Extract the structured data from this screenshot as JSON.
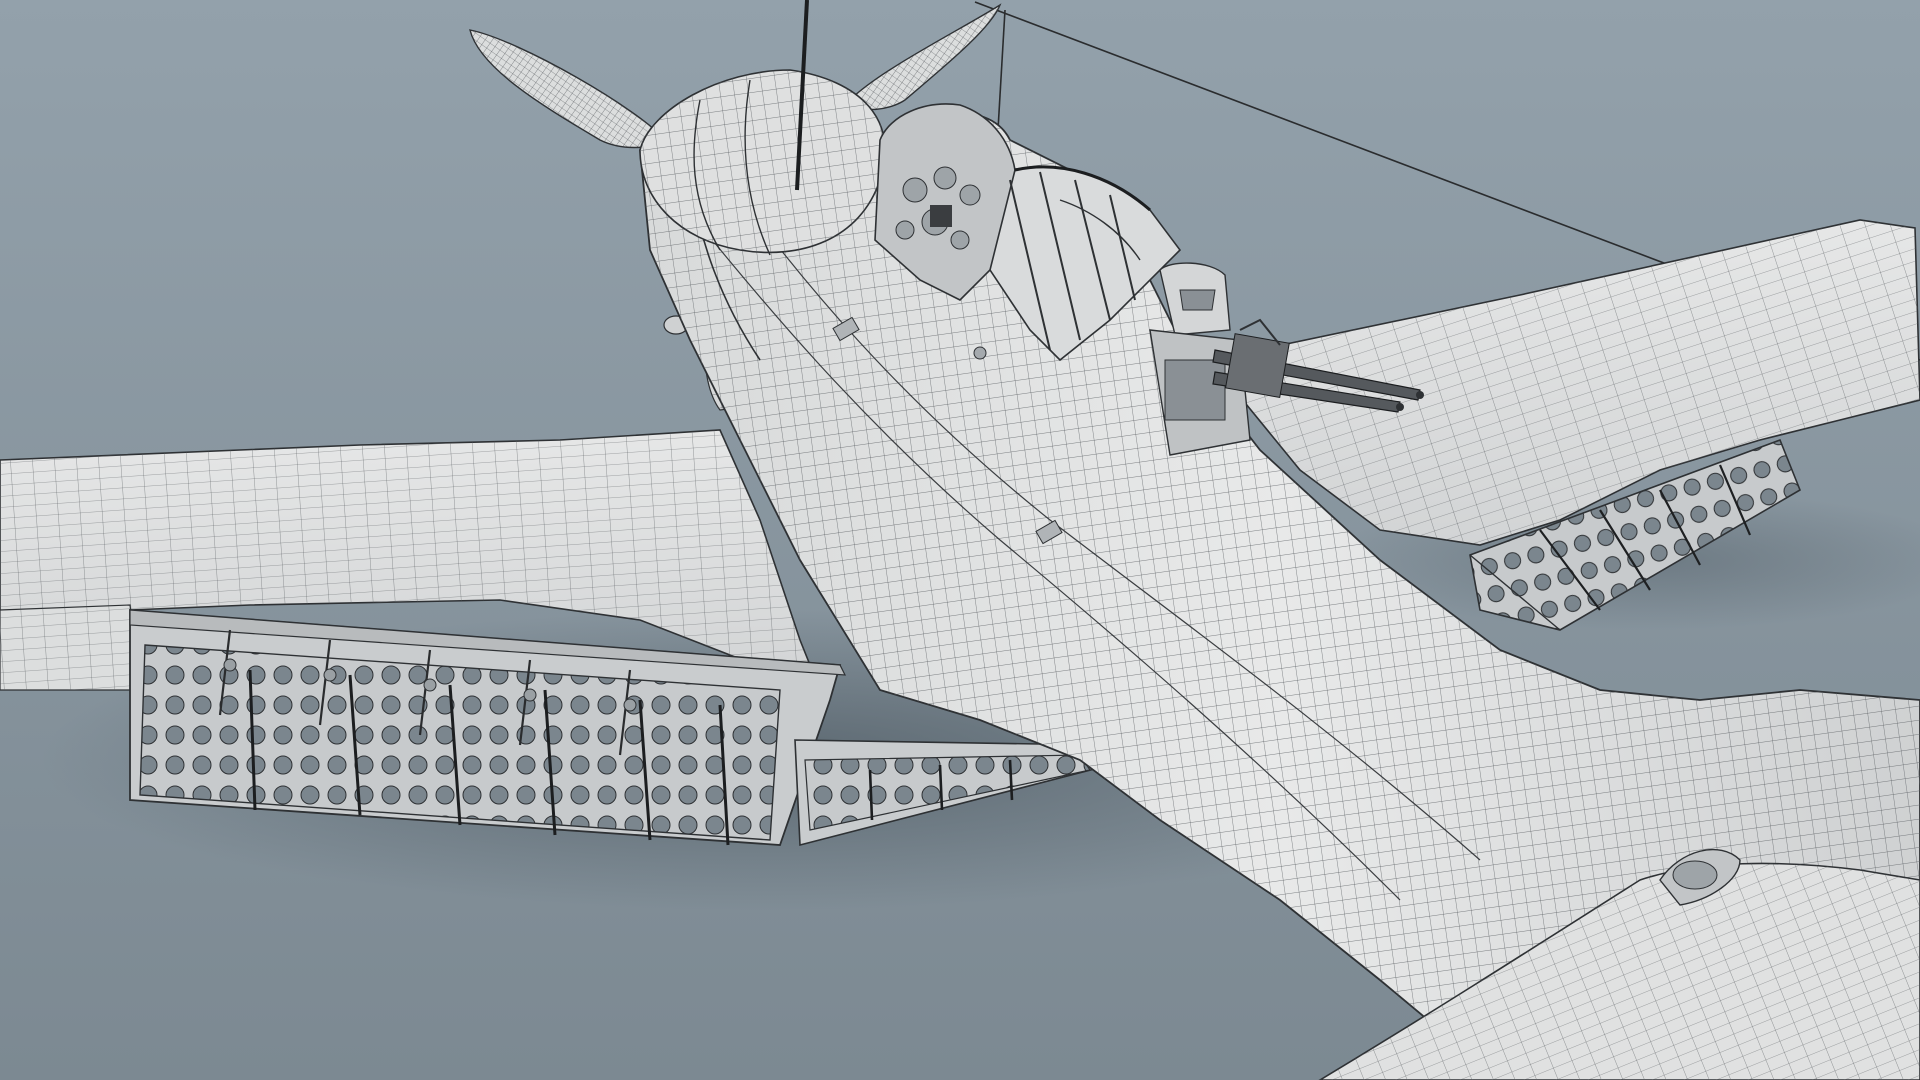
{
  "scene": {
    "subject": "aircraft-wireframe",
    "colors": {
      "background_top": "#93a1ab",
      "background_bottom": "#7f8c95",
      "shadow": "#5e6a72",
      "surface": "#e3e4e4",
      "surface_shade": "#c9cbcc",
      "wire": "#3a3d40",
      "wire_light": "#8d9094",
      "flap_panel": "#c4c7c9",
      "flap_hole": "#78838b",
      "gun_metal": "#55595d"
    },
    "icons": {
      "propeller": "propeller-icon",
      "canopy": "canopy-icon",
      "machine_gun": "machine-gun-icon",
      "antenna": "antenna-icon"
    }
  }
}
